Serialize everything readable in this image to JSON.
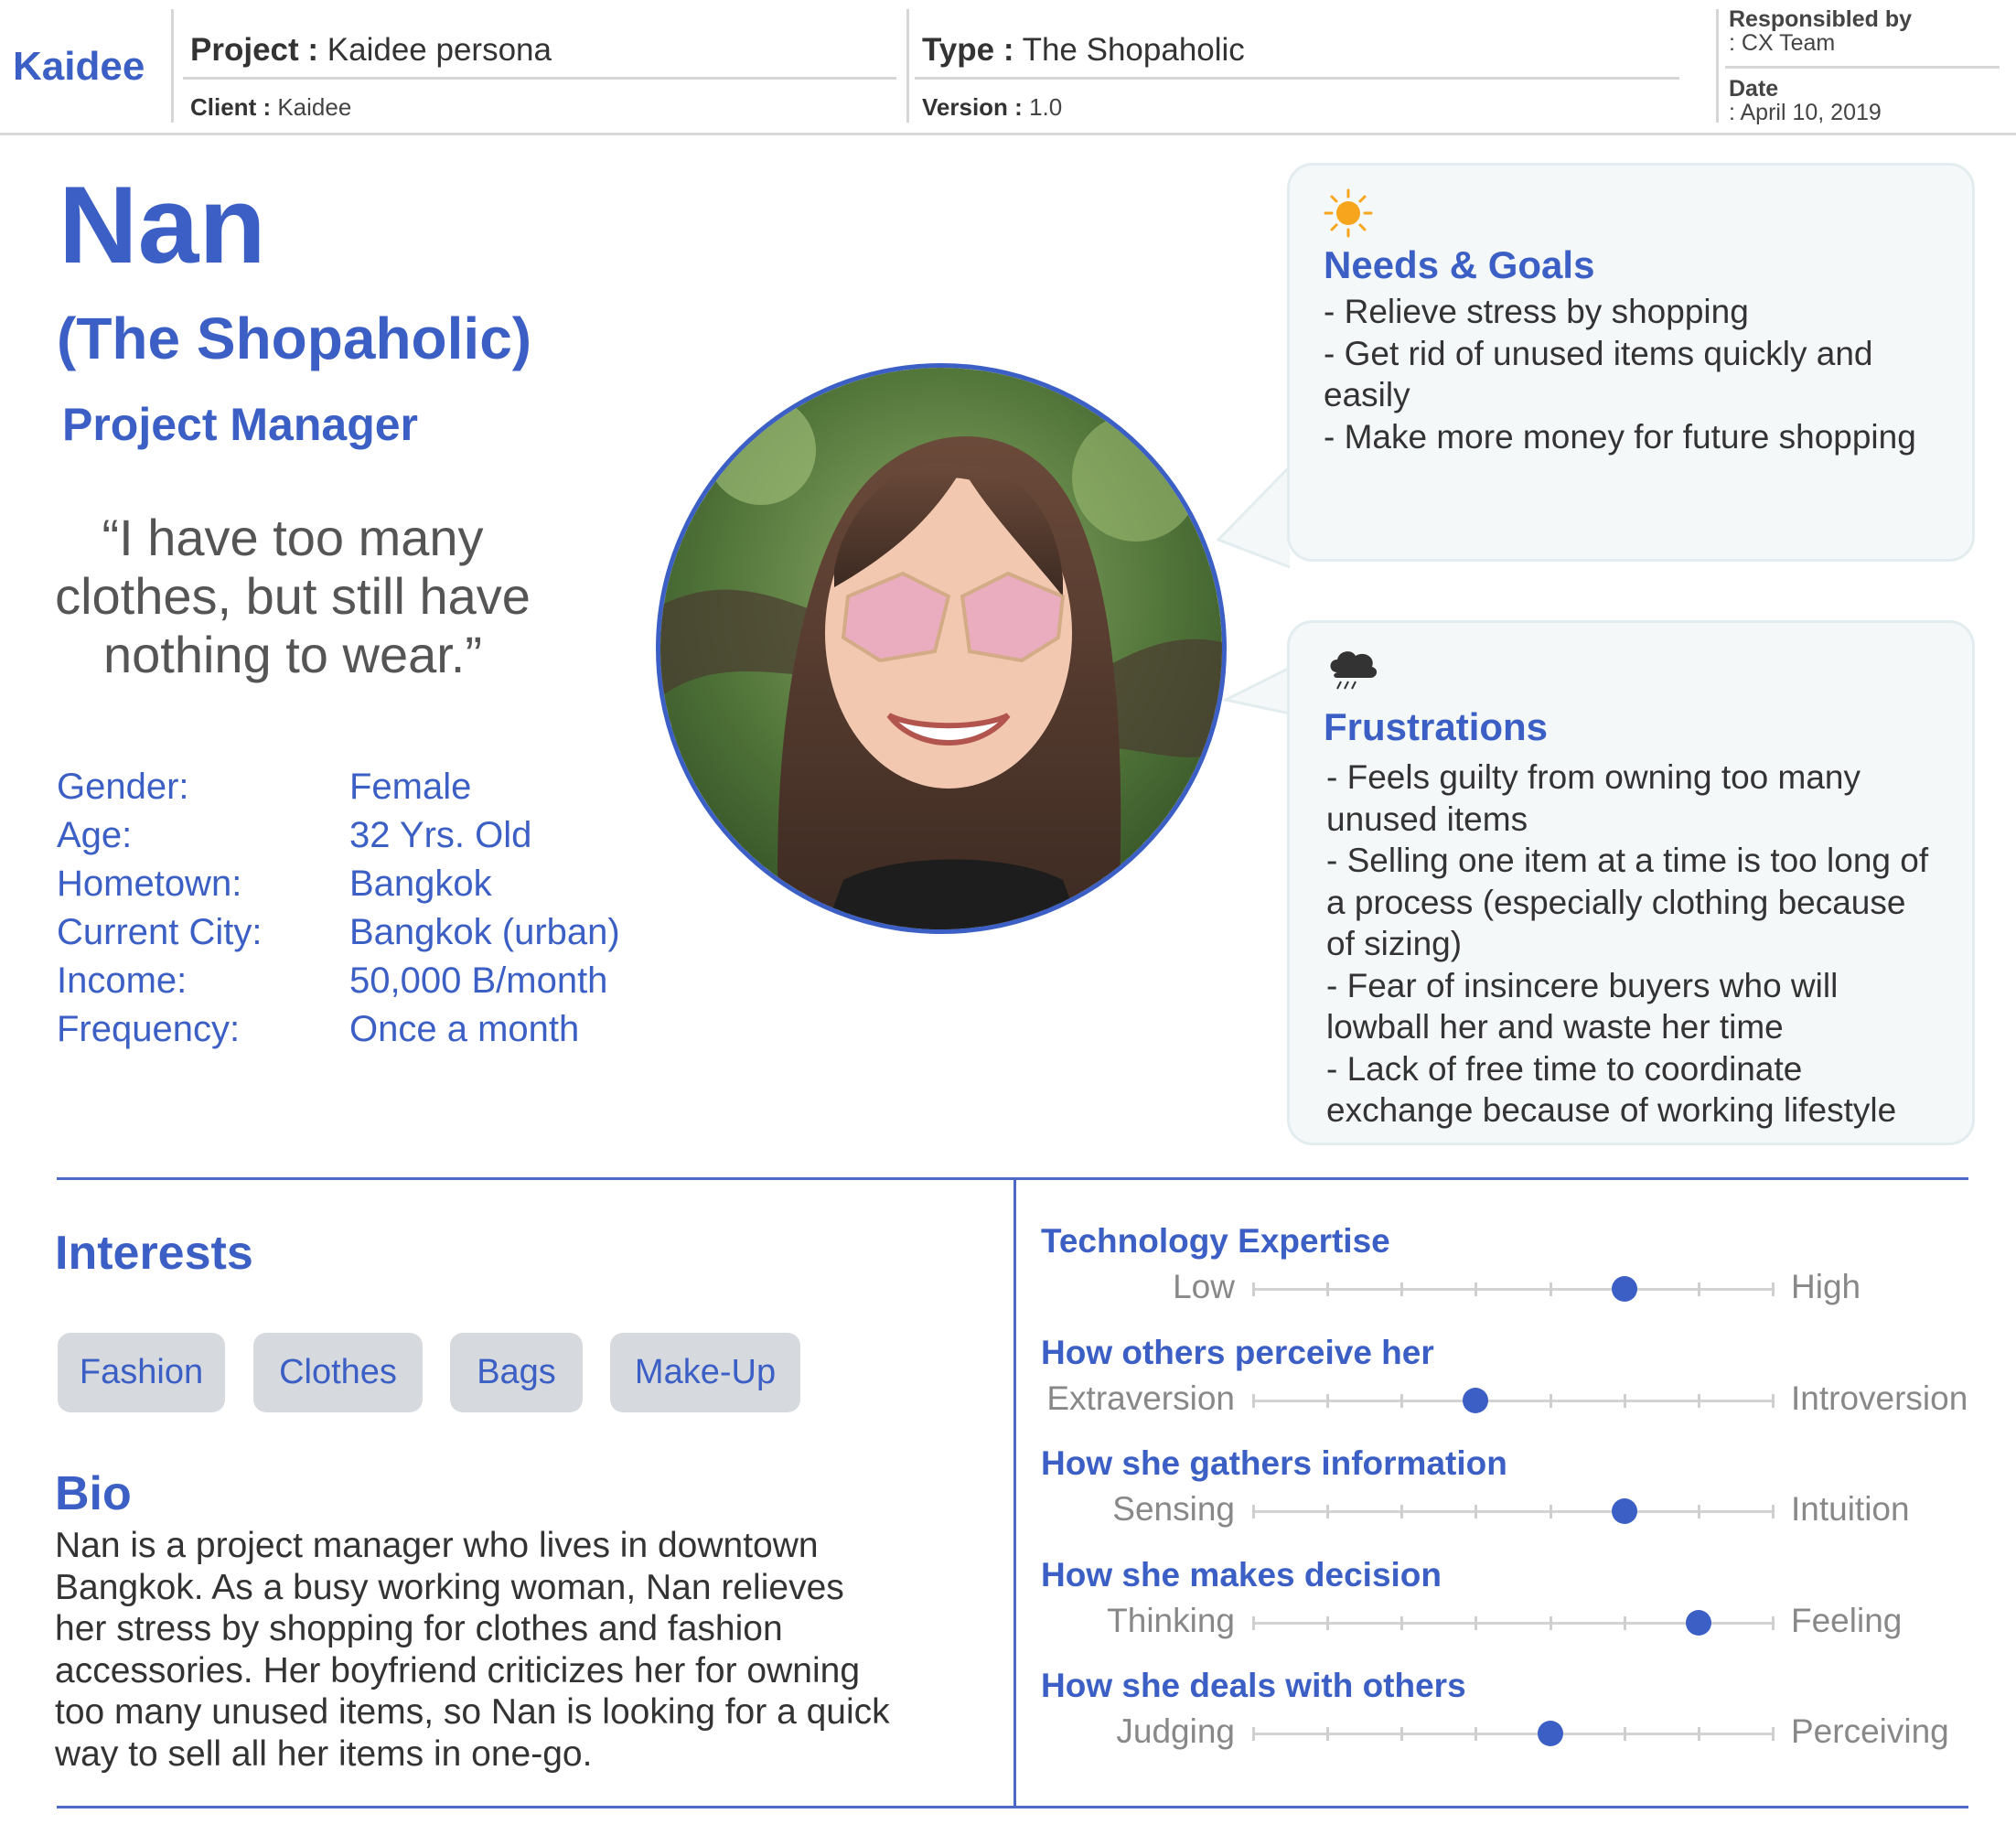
{
  "header": {
    "logo": "Kaidee",
    "project_label": "Project :",
    "project_value": "Kaidee persona",
    "client_label": "Client :",
    "client_value": "Kaidee",
    "type_label": "Type :",
    "type_value": "The Shopaholic",
    "version_label": "Version :",
    "version_value": "1.0",
    "responsible_label": "Responsibled by",
    "responsible_value": ": CX Team",
    "date_label": "Date",
    "date_value": ": April 10, 2019"
  },
  "persona": {
    "name": "Nan",
    "alias": "(The Shopaholic)",
    "role": "Project Manager",
    "quote_lines": [
      "“I have too many",
      "clothes, but still have",
      "nothing to wear.”"
    ],
    "details": [
      {
        "label": "Gender:",
        "value": "Female"
      },
      {
        "label": "Age:",
        "value": "32 Yrs. Old"
      },
      {
        "label": "Hometown:",
        "value": "Bangkok"
      },
      {
        "label": "Current City:",
        "value": "Bangkok (urban)"
      },
      {
        "label": "Income:",
        "value": "50,000 B/month"
      },
      {
        "label": "Frequency:",
        "value": "Once a month"
      }
    ]
  },
  "needs": {
    "icon": "sun-icon",
    "title": "Needs & Goals",
    "lines": [
      "- Relieve stress by shopping",
      "- Get rid of unused items quickly and",
      "easily",
      "- Make more money for future shopping"
    ]
  },
  "frustrations": {
    "icon": "rain-cloud-icon",
    "title": "Frustrations",
    "lines": [
      "-  Feels guilty from owning too many",
      "unused items",
      "- Selling one item at a time is too long of",
      "a process (especially clothing because",
      "of sizing)",
      "- Fear of insincere buyers who will",
      "lowball her and waste her time",
      "- Lack of free time to coordinate",
      "exchange because of working lifestyle"
    ]
  },
  "interests": {
    "title": "Interests",
    "tags": [
      "Fashion",
      "Clothes",
      "Bags",
      "Make-Up"
    ]
  },
  "bio": {
    "title": "Bio",
    "lines": [
      "Nan is a project manager who lives in downtown",
      "Bangkok. As a busy working woman, Nan relieves",
      "her stress by shopping for clothes and fashion",
      "accessories. Her boyfriend criticizes her for owning",
      "too many unused items, so Nan is looking for a quick",
      "way to sell all her items in one-go."
    ]
  },
  "scales": [
    {
      "title": "Technology Expertise",
      "left": "Low",
      "right": "High",
      "level": 5,
      "steps": 7
    },
    {
      "title": "How others perceive her",
      "left": "Extraversion",
      "right": "Introversion",
      "level": 3,
      "steps": 7
    },
    {
      "title": "How she gathers information",
      "left": "Sensing",
      "right": "Intuition",
      "level": 5,
      "steps": 7
    },
    {
      "title": "How she makes decision",
      "left": "Thinking",
      "right": "Feeling",
      "level": 6,
      "steps": 7
    },
    {
      "title": "How she deals with others",
      "left": "Judging",
      "right": "Perceiving",
      "level": 4,
      "steps": 7
    }
  ],
  "colors": {
    "accent": "#3b5fc4",
    "card_bg": "#f4f8f9",
    "chip_bg": "#d6dade"
  }
}
